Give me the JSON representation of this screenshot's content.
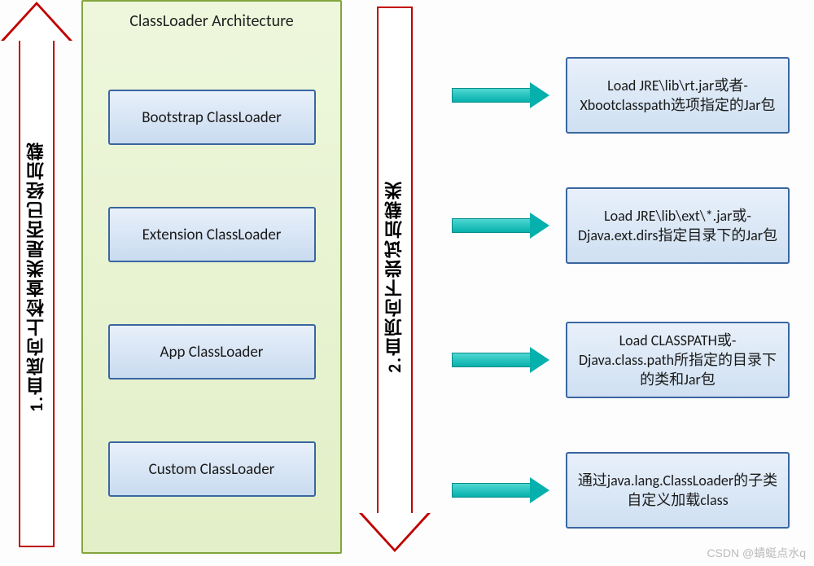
{
  "title": "ClassLoader Architecture",
  "left_arrow_label": "1.自底向上检查类是否已经加载",
  "right_arrow_label": "2.自顶向下尝试加载类",
  "loaders": [
    {
      "name": "Bootstrap ClassLoader",
      "desc": "Load JRE\\lib\\rt.jar或者-Xbootclasspath选项指定的Jar包"
    },
    {
      "name": "Extension ClassLoader",
      "desc": "Load JRE\\lib\\ext\\*.jar或-Djava.ext.dirs指定目录下的Jar包"
    },
    {
      "name": "App ClassLoader",
      "desc": "Load CLASSPATH或-Djava.class.path所指定的目录下的类和Jar包"
    },
    {
      "name": "Custom ClassLoader",
      "desc": "通过java.lang.ClassLoader的子类自定义加载class"
    }
  ],
  "row_y": [
    70,
    230,
    395,
    555
  ],
  "desc_heights": [
    94,
    94,
    94,
    94
  ],
  "watermark": "CSDN @蜻蜓点水q",
  "colors": {
    "red": "#c00000",
    "green_border": "#82a53c",
    "blue_border": "#3a66a0",
    "teal": "#06b0ac"
  }
}
